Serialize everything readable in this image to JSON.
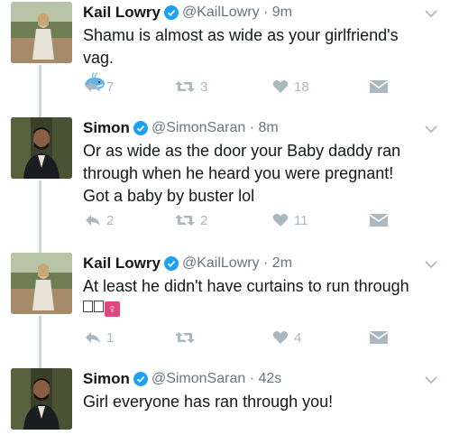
{
  "tweets": [
    {
      "name": "Kail Lowry",
      "handle": "@KailLowry · 9m",
      "text": "Shamu is almost as wide as your girlfriend's vag.",
      "emoji": "whale-emoji",
      "replies": "7",
      "retweets": "3",
      "likes": "18"
    },
    {
      "name": "Simon",
      "handle": "@SimonSaran · 8m",
      "text": "Or as wide as the door your Baby daddy ran through when he heard you were pregnant! Got a baby by buster lol",
      "replies": "2",
      "retweets": "2",
      "likes": "11"
    },
    {
      "name": "Kail Lowry",
      "handle": "@KailLowry · 2m",
      "text": "At least he didn't have curtains to run through",
      "emoji": "female-sign-emoji",
      "replies": "1",
      "retweets": "",
      "likes": "4"
    },
    {
      "name": "Simon",
      "handle": "@SimonSaran · 42s",
      "text": "Girl everyone has ran through you!"
    }
  ],
  "icons": {
    "verified": "verified-badge-icon",
    "reply": "reply-icon",
    "retweet": "retweet-icon",
    "like": "heart-icon",
    "dm": "direct-message-icon",
    "caret": "chevron-down-icon"
  },
  "colors": {
    "verified": "#1da1f2",
    "icon_gray": "#aab8c2",
    "handle_gray": "#657786",
    "thread_line": "#ccd6dd"
  }
}
